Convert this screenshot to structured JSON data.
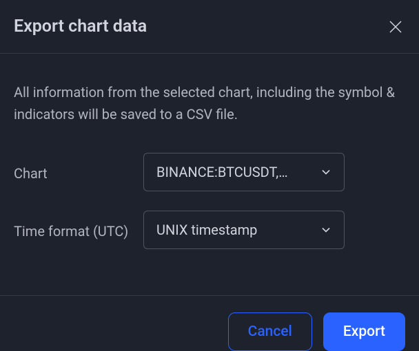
{
  "title": "Export chart data",
  "description": "All information from the selected chart, including the symbol & indicators will be saved to a CSV file.",
  "fields": {
    "chart": {
      "label": "Chart",
      "value": "BINANCE:BTCUSDT,…"
    },
    "timeFormat": {
      "label": "Time format (UTC)",
      "value": "UNIX timestamp"
    }
  },
  "buttons": {
    "cancel": "Cancel",
    "export": "Export"
  }
}
